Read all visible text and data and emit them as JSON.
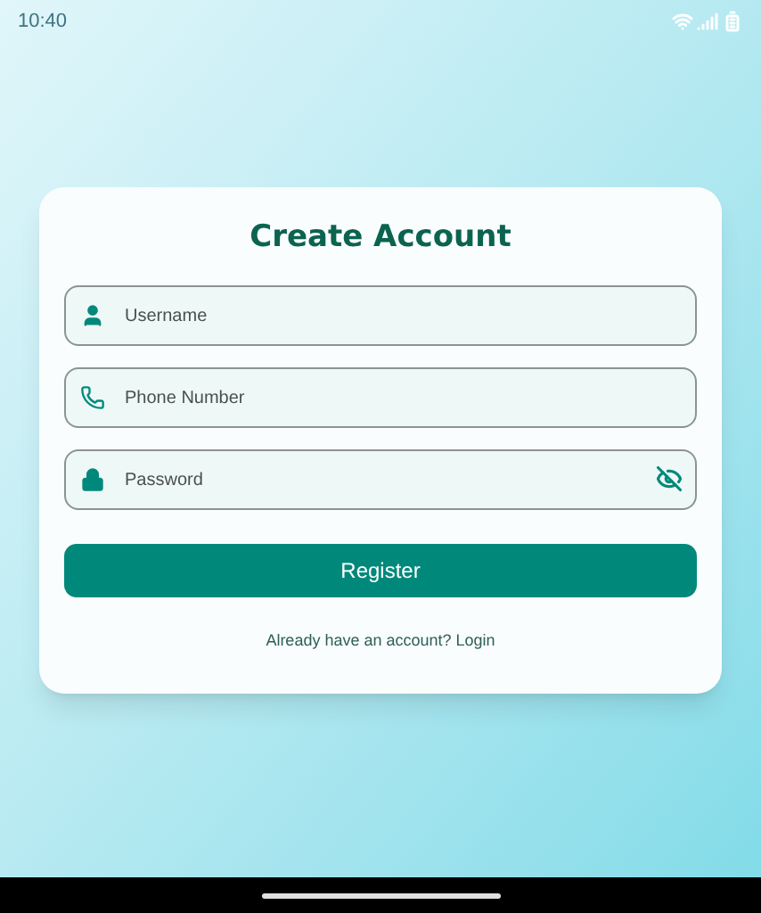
{
  "status_bar": {
    "time": "10:40"
  },
  "title": "Create Account",
  "fields": [
    {
      "kind": "user",
      "placeholder": "Username"
    },
    {
      "kind": "phone",
      "placeholder": "Phone Number"
    },
    {
      "kind": "lock",
      "placeholder": "Password",
      "password_hidden": true
    }
  ],
  "submit": {
    "label": "Register"
  },
  "footer": {
    "prompt": "Already have an account?",
    "link": "Login"
  }
}
